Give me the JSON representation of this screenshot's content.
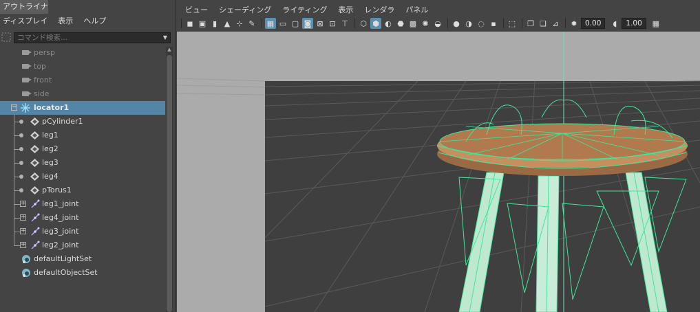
{
  "outliner": {
    "title": "アウトライナ",
    "menu": [
      "ディスプレイ",
      "表示",
      "ヘルプ"
    ],
    "search_placeholder": "コマンド検索...",
    "items": [
      {
        "label": "persp"
      },
      {
        "label": "top"
      },
      {
        "label": "front"
      },
      {
        "label": "side"
      },
      {
        "label": "locator1"
      },
      {
        "label": "pCylinder1"
      },
      {
        "label": "leg1"
      },
      {
        "label": "leg2"
      },
      {
        "label": "leg3"
      },
      {
        "label": "leg4"
      },
      {
        "label": "pTorus1"
      },
      {
        "label": "leg1_joint"
      },
      {
        "label": "leg4_joint"
      },
      {
        "label": "leg3_joint"
      },
      {
        "label": "leg2_joint"
      },
      {
        "label": "defaultLightSet"
      },
      {
        "label": "defaultObjectSet"
      }
    ]
  },
  "panel": {
    "menu": [
      "ビュー",
      "シェーディング",
      "ライティング",
      "表示",
      "レンダラ",
      "パネル"
    ],
    "toolbar": {
      "exposure": "0.00",
      "gamma": "1.00"
    }
  },
  "colors": {
    "selection": "#5285a6",
    "wireframe": "#3fe79a",
    "stool_wood": "#b07a4e",
    "viewport_bg": "#ababab",
    "grid_floor": "#3f3f3f"
  }
}
